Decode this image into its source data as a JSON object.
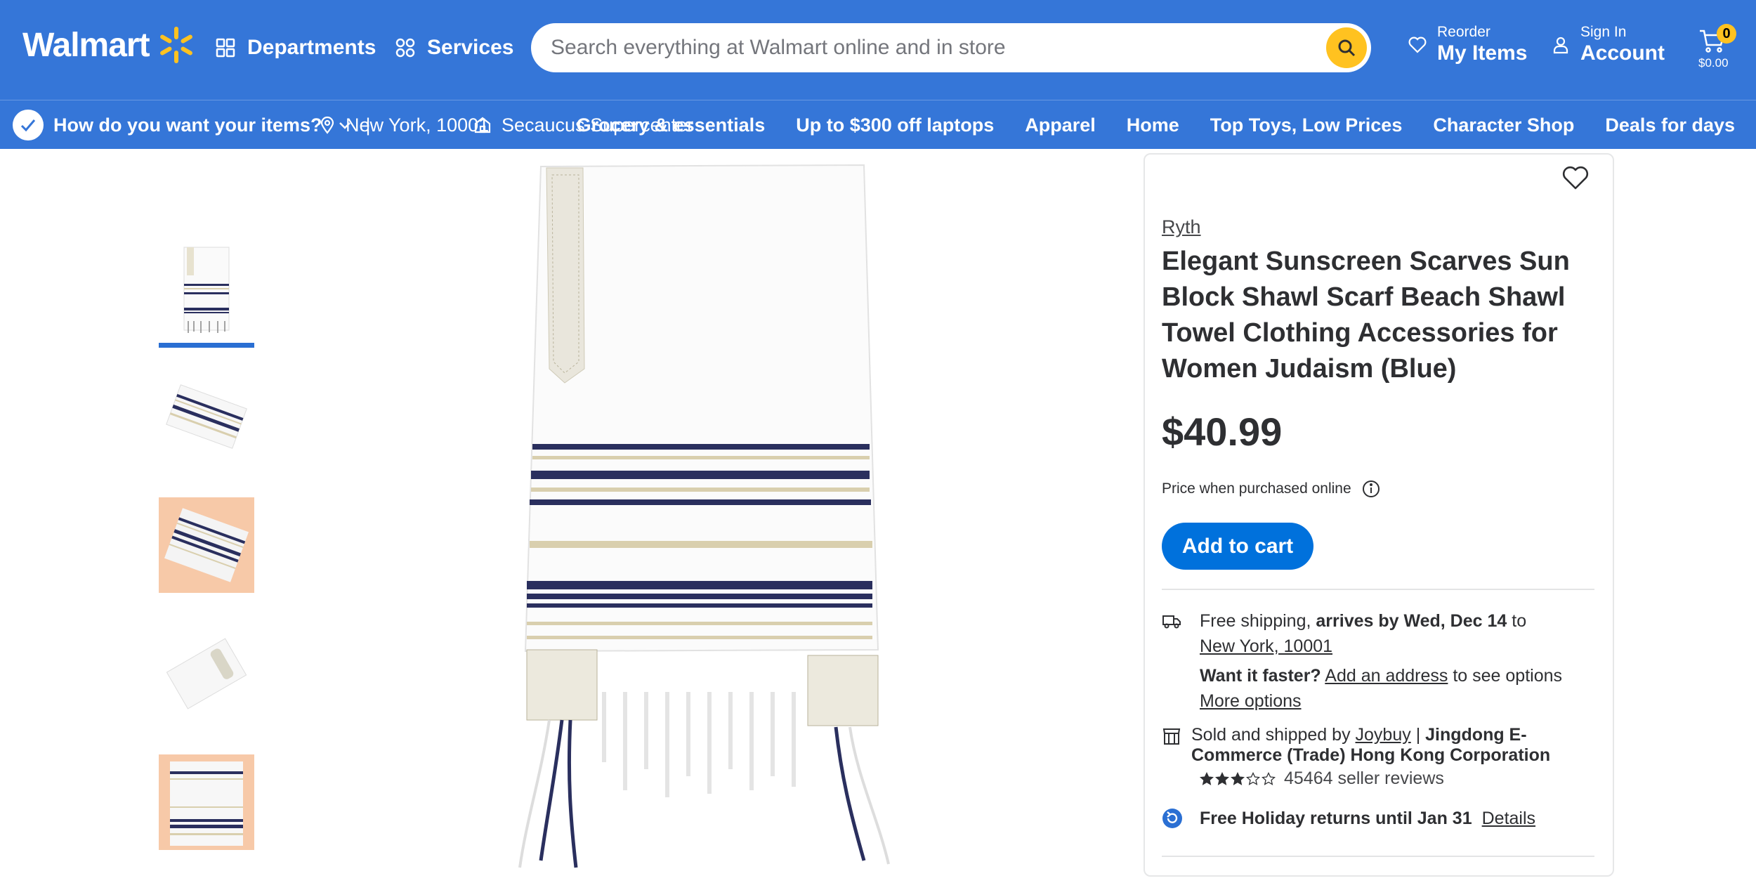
{
  "header": {
    "logo_text": "Walmart",
    "departments_label": "Departments",
    "services_label": "Services",
    "search_placeholder": "Search everything at Walmart online and in store",
    "reorder_small": "Reorder",
    "reorder_big": "My Items",
    "account_small": "Sign In",
    "account_big": "Account",
    "cart_count": "0",
    "cart_total": "$0.00"
  },
  "subbar": {
    "delivery_prompt": "How do you want your items?",
    "separator": "|",
    "location": "New York, 10001",
    "store": "Secaucus Supercenter",
    "nav_links": [
      "Grocery & essentials",
      "Up to $300 off laptops",
      "Apparel",
      "Home",
      "Top Toys, Low Prices",
      "Character Shop",
      "Deals for days"
    ]
  },
  "product": {
    "brand": "Ryth",
    "title": "Elegant Sunscreen Scarves Sun Block Shawl Scarf Beach Shawl Towel Clothing Accessories for Women Judaism (Blue)",
    "price": "$40.99",
    "price_note": "Price when purchased online",
    "add_to_cart": "Add to cart"
  },
  "shipping": {
    "free_shipping": "Free shipping,",
    "arrives": "arrives by Wed, Dec 14",
    "to": "to",
    "address": "New York, 10001",
    "faster_q": "Want it faster?",
    "add_address": "Add an address",
    "see_options": "to see options",
    "more_options": "More options"
  },
  "seller": {
    "sold_by": "Sold and shipped by",
    "seller_link": "Joybuy",
    "separator": "|",
    "company": "Jingdong E-Commerce (Trade) Hong Kong Corporation",
    "rating": 3,
    "rating_max": 5,
    "reviews": "45464 seller reviews"
  },
  "returns": {
    "text": "Free Holiday returns until Jan 31",
    "details": "Details"
  },
  "colors": {
    "header_blue": "#3576d8",
    "spark_yellow": "#ffc220",
    "button_blue": "#0071dc",
    "stripe_navy": "#2a2f5e",
    "stripe_gold": "#d9cfae"
  },
  "icons": [
    "spark-logo-icon",
    "grid-icon",
    "services-icon",
    "search-icon",
    "heart-icon",
    "person-icon",
    "cart-icon",
    "pickup-icon",
    "chevron-down-icon",
    "location-pin-icon",
    "store-icon",
    "info-icon",
    "truck-icon",
    "store-box-icon",
    "star-icon",
    "return-icon"
  ]
}
